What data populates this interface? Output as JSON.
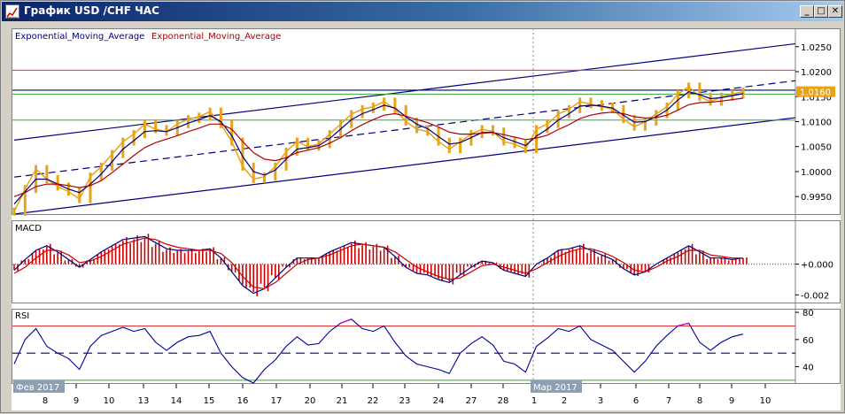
{
  "window": {
    "title": "График USD /CHF ЧАС",
    "minimize_glyph": "_",
    "maximize_glyph": "□",
    "close_glyph": "✕"
  },
  "indicators": {
    "ema_label_1": "Exponential_Moving_Average",
    "ema_label_2": "Exponential_Moving_Average",
    "macd_label": "MACD",
    "rsi_label": "RSI"
  },
  "colors": {
    "price": "#e8a317",
    "ema_fast": "#000080",
    "ema_slow": "#b00000",
    "channel": "#000080",
    "hline_red": "#dd3333",
    "hline_green": "#33aa33",
    "macd_hist": "#cc0000",
    "rsi_line": "#000099",
    "rsi_overbought": "#cc00cc",
    "rsi_oversold": "#22aa22",
    "last_price_bg": "#e8a317"
  },
  "chart_data": [
    {
      "type": "line",
      "panel": "price",
      "symbol": "USD/CHF",
      "timeframe": "H1",
      "current_price": "1.0160",
      "ylim": [
        0.9915,
        1.0285
      ],
      "y_ticks": [
        "1.0250",
        "1.0200",
        "1.0150",
        "1.0100",
        "1.0050",
        "1.0000",
        "0.9950"
      ],
      "x_ticks": [
        "8",
        "9",
        "10",
        "13",
        "14",
        "15",
        "16",
        "17",
        "20",
        "21",
        "22",
        "23",
        "24",
        "27",
        "28",
        "1",
        "2",
        "3",
        "6",
        "7",
        "8",
        "9",
        "10"
      ],
      "x_period_labels": [
        "Фев 2017",
        "Мар 2017"
      ],
      "horizontal_levels": [
        {
          "value": 1.0203,
          "color": "red"
        },
        {
          "value": 1.0155,
          "color": "green"
        },
        {
          "value": 1.0103,
          "color": "green"
        }
      ],
      "series": [
        {
          "name": "Exponential_Moving_Average",
          "role": "price",
          "values": [
            0.992,
            0.9965,
            1.0005,
            0.9985,
            0.997,
            0.996,
            0.9945,
            0.999,
            1.001,
            1.0035,
            1.006,
            1.0075,
            1.0095,
            1.0085,
            1.008,
            1.0095,
            1.0105,
            1.011,
            1.012,
            1.0095,
            1.006,
            1.001,
            0.9985,
            0.999,
            1.001,
            1.004,
            1.006,
            1.005,
            1.0055,
            1.0075,
            1.0095,
            1.0115,
            1.0125,
            1.013,
            1.014,
            1.0125,
            1.01,
            1.0085,
            1.008,
            1.006,
            1.0045,
            1.006,
            1.0075,
            1.0085,
            1.008,
            1.006,
            1.0055,
            1.0045,
            1.0085,
            1.0095,
            1.0115,
            1.0125,
            1.014,
            1.0135,
            1.013,
            1.0125,
            1.0105,
            1.009,
            1.01,
            1.0115,
            1.013,
            1.0155,
            1.017,
            1.015,
            1.014,
            1.015,
            1.0155,
            1.016
          ]
        },
        {
          "name": "Exponential_Moving_Average",
          "role": "ema_fast",
          "values": [
            0.9935,
            0.996,
            0.9985,
            0.9985,
            0.9975,
            0.9965,
            0.9958,
            0.9975,
            0.9995,
            1.002,
            1.0045,
            1.0062,
            1.008,
            1.0082,
            1.008,
            1.0088,
            1.0097,
            1.0104,
            1.0112,
            1.01,
            1.0072,
            1.003,
            1.0,
            0.9993,
            1.0003,
            1.0025,
            1.0045,
            1.0048,
            1.0052,
            1.0066,
            1.0085,
            1.0104,
            1.0116,
            1.0124,
            1.0133,
            1.0127,
            1.011,
            1.0095,
            1.0086,
            1.007,
            1.0055,
            1.0058,
            1.0068,
            1.0078,
            1.0079,
            1.0068,
            1.006,
            1.0052,
            1.0071,
            1.0085,
            1.0103,
            1.0116,
            1.0131,
            1.0133,
            1.0131,
            1.0127,
            1.0113,
            1.0099,
            1.01,
            1.011,
            1.0123,
            1.0143,
            1.016,
            1.0154,
            1.0146,
            1.0148,
            1.0152,
            1.0156
          ]
        },
        {
          "name": "Exponential_Moving_Average",
          "role": "ema_slow",
          "values": [
            0.995,
            0.9958,
            0.997,
            0.9975,
            0.9975,
            0.9972,
            0.9968,
            0.9972,
            0.9982,
            0.9998,
            1.0015,
            1.0032,
            1.0048,
            1.0058,
            1.0065,
            1.0072,
            1.008,
            1.0087,
            1.0095,
            1.0095,
            1.0085,
            1.006,
            1.0038,
            1.0025,
            1.0022,
            1.0028,
            1.0038,
            1.0043,
            1.0048,
            1.0057,
            1.0068,
            1.0082,
            1.0094,
            1.0104,
            1.0113,
            1.0116,
            1.0111,
            1.0104,
            1.0098,
            1.0089,
            1.0079,
            1.0075,
            1.0075,
            1.0077,
            1.0078,
            1.0074,
            1.0069,
            1.0064,
            1.0067,
            1.0073,
            1.0084,
            1.0094,
            1.0106,
            1.0113,
            1.0117,
            1.0119,
            1.0116,
            1.011,
            1.0107,
            1.0108,
            1.0113,
            1.0123,
            1.0134,
            1.0138,
            1.0139,
            1.0141,
            1.0144,
            1.0147
          ]
        }
      ]
    },
    {
      "type": "bar",
      "panel": "macd",
      "ylim": [
        -0.0025,
        0.0028
      ],
      "y_ticks": [
        "+0.000",
        "-0.002"
      ],
      "series": [
        {
          "name": "MACD",
          "values": [
            -0.0004,
            0.0003,
            0.0009,
            0.0012,
            0.0008,
            0.0003,
            -0.0002,
            0.0003,
            0.0008,
            0.0012,
            0.0016,
            0.0017,
            0.0018,
            0.0014,
            0.001,
            0.0009,
            0.0009,
            0.0009,
            0.001,
            0.0004,
            -0.0005,
            -0.0014,
            -0.0019,
            -0.0016,
            -0.0009,
            -0.0002,
            0.0004,
            0.0004,
            0.0004,
            0.0008,
            0.0011,
            0.0014,
            0.0013,
            0.0012,
            0.0011,
            0.0005,
            -0.0002,
            -0.0006,
            -0.0007,
            -0.001,
            -0.0012,
            -0.0007,
            -0.0002,
            0.0002,
            0.0001,
            -0.0004,
            -0.0006,
            -0.0008,
            0.0,
            0.0004,
            0.0009,
            0.001,
            0.0012,
            0.0009,
            0.0006,
            0.0003,
            -0.0003,
            -0.0007,
            -0.0005,
            0.0,
            0.0004,
            0.0008,
            0.0012,
            0.0008,
            0.0004,
            0.0004,
            0.0003,
            0.0004
          ]
        },
        {
          "name": "Signal",
          "values": [
            -0.0006,
            -0.0002,
            0.0004,
            0.0009,
            0.0009,
            0.0006,
            0.0001,
            0.0002,
            0.0005,
            0.0009,
            0.0013,
            0.0015,
            0.0017,
            0.0016,
            0.0013,
            0.0011,
            0.001,
            0.0009,
            0.0009,
            0.0007,
            0.0001,
            -0.0008,
            -0.0015,
            -0.0016,
            -0.0012,
            -0.0006,
            0.0,
            0.0003,
            0.0004,
            0.0006,
            0.0009,
            0.0012,
            0.0013,
            0.0012,
            0.0011,
            0.0008,
            0.0003,
            -0.0002,
            -0.0005,
            -0.0008,
            -0.001,
            -0.0009,
            -0.0005,
            -0.0001,
            0.0,
            -0.0002,
            -0.0004,
            -0.0006,
            -0.0003,
            0.0001,
            0.0005,
            0.0008,
            0.001,
            0.001,
            0.0008,
            0.0005,
            0.0001,
            -0.0004,
            -0.0005,
            -0.0002,
            0.0002,
            0.0005,
            0.0009,
            0.0009,
            0.0006,
            0.0005,
            0.0004,
            0.0004
          ]
        }
      ]
    },
    {
      "type": "line",
      "panel": "rsi",
      "ylim": [
        28,
        82
      ],
      "y_ticks": [
        "80",
        "60",
        "40"
      ],
      "levels": [
        70,
        50,
        30
      ],
      "series": [
        {
          "name": "RSI",
          "values": [
            42,
            60,
            68,
            55,
            50,
            46,
            38,
            55,
            63,
            66,
            69,
            66,
            68,
            58,
            52,
            58,
            62,
            63,
            66,
            50,
            40,
            32,
            28,
            38,
            45,
            55,
            62,
            56,
            57,
            66,
            72,
            75,
            68,
            66,
            70,
            58,
            48,
            42,
            40,
            38,
            35,
            50,
            57,
            62,
            56,
            44,
            42,
            36,
            55,
            61,
            68,
            66,
            70,
            60,
            56,
            52,
            44,
            36,
            44,
            55,
            63,
            70,
            72,
            58,
            52,
            58,
            62,
            64
          ]
        }
      ]
    }
  ]
}
